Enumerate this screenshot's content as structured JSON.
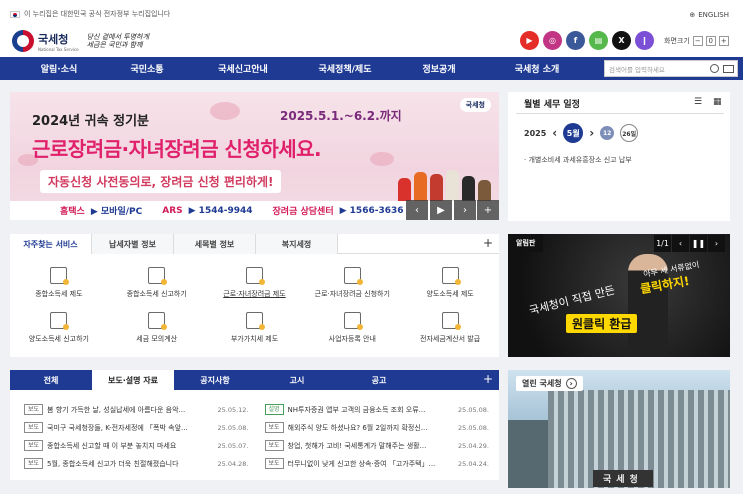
{
  "top": {
    "gov_notice": "이 누리집은 대한민국 공식 전자정부 누리집입니다",
    "english": "ENGLISH"
  },
  "logo": {
    "name": "국세청",
    "sub": "National Tax Service",
    "slogan_line1": "당신 곁에서 투명하게",
    "slogan_line2": "세금은 국민과 함께"
  },
  "sns": [
    {
      "label": "▶",
      "color": "#e52d27",
      "icon": "youtube-icon"
    },
    {
      "label": "◎",
      "color": "#c13584",
      "icon": "instagram-icon"
    },
    {
      "label": "f",
      "color": "#3b5998",
      "icon": "facebook-icon"
    },
    {
      "label": "▤",
      "color": "#55b84a",
      "icon": "blog-icon"
    },
    {
      "label": "X",
      "color": "#111111",
      "icon": "x-icon"
    },
    {
      "label": "❙",
      "color": "#7b4fd6",
      "icon": "chat-icon"
    }
  ],
  "font_size": {
    "label": "화면크기",
    "minus": "−",
    "zero": "0",
    "plus": "+"
  },
  "nav": [
    "알림·소식",
    "국민소통",
    "국세신고안내",
    "국세정책/제도",
    "정보공개",
    "국세청 소개"
  ],
  "search": {
    "placeholder": "검색어를 입력하세요"
  },
  "banner": {
    "year_title": "2024년 귀속 정기분",
    "date": "2025.5.1.~6.2.까지",
    "main": "근로장려금·자녀장려금 신청하세요.",
    "sub": "자동신청 사전동의로, 장려금 신청 편리하게!",
    "foot_hometax": "홈택스",
    "foot_mobile": "▶ 모바일/PC",
    "foot_ars": "ARS",
    "foot_ars_num": "▶ 1544-9944",
    "foot_center": "장려금 상담센터",
    "foot_center_num": "▶ 1566-3636",
    "logo": "국세청",
    "ctrl_prev": "‹",
    "ctrl_play": "▶",
    "ctrl_next": "›",
    "ctrl_plus": "+"
  },
  "calendar": {
    "title": "월별 세무 일정",
    "year": "2025",
    "month": "5월",
    "day1": "12",
    "day2": "26일",
    "item": "· 개별소비세 과세유흥장소 신고 납부",
    "prev": "‹",
    "next": "›"
  },
  "service_tabs": [
    "자주찾는 서비스",
    "납세자별 정보",
    "세목별 정보",
    "복지세정"
  ],
  "services": [
    "종합소득세 제도",
    "종합소득세 신고하기",
    "근로·자녀장려금 제도",
    "근로·자녀장려금 신청하기",
    "양도소득세 제도",
    "양도소득세 신고하기",
    "세금 모의계산",
    "부가가치세 제도",
    "사업자등록 안내",
    "전자세금계산서 발급"
  ],
  "notice_board": {
    "tag": "알림판",
    "counter": "1/1",
    "prev": "‹",
    "pause": "❚❚",
    "next": "›",
    "line1": "아무 세 서류없이",
    "line2": "클릭하지!",
    "line3": "국세청이 직접 만든",
    "line4": "원클릭 환급"
  },
  "news_tabs": [
    "전체",
    "보도·설명 자료",
    "공지사항",
    "고시",
    "공고"
  ],
  "news": [
    {
      "badge": "보도",
      "text": "봄 향기 가득한 날, 성실납세에 아름다운 음악...",
      "date": "25.05.12.",
      "green": false
    },
    {
      "badge": "설명",
      "text": "NH투자증권 앱부 고객의 금융소득 조회 오류...",
      "date": "25.05.08.",
      "green": true
    },
    {
      "badge": "보도",
      "text": "국미구 국세청장들, K-전자세정에 「폭박 속앞...",
      "date": "25.05.08.",
      "green": false
    },
    {
      "badge": "보도",
      "text": "해외주식 양도 하셨나요? 6월 2일까지 확정신...",
      "date": "25.05.08.",
      "green": false
    },
    {
      "badge": "보도",
      "text": "종합소득세 신고할 때 이 부분 놓치지 마세요",
      "date": "25.05.07.",
      "green": false
    },
    {
      "badge": "보도",
      "text": "창업, 첫해가 고비! 국세통계가 말해주는 생활...",
      "date": "25.04.29.",
      "green": false
    },
    {
      "badge": "보도",
      "text": "5월, 종합소득세 신고가 더욱 친절해졌습니다",
      "date": "25.04.28.",
      "green": false
    },
    {
      "badge": "보도",
      "text": "터무니없이 낮게 신고한 상속·증여 「고가주택」...",
      "date": "25.04.24.",
      "green": false
    }
  ],
  "open_nts": {
    "tag": "열린 국세청",
    "sign": "국세청",
    "arrow": "›"
  }
}
